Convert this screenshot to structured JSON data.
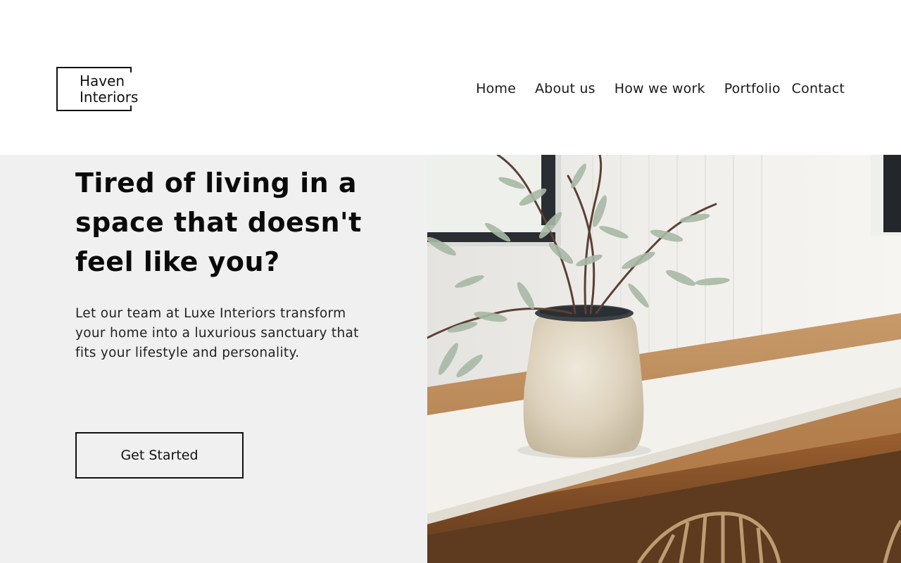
{
  "brand": {
    "logo_line1": "Haven",
    "logo_line2": "Interiors"
  },
  "nav": {
    "items": [
      {
        "label": "Home"
      },
      {
        "label": "About us"
      },
      {
        "label": "How we work"
      },
      {
        "label": "Portfolio"
      },
      {
        "label": "Contact"
      }
    ]
  },
  "hero": {
    "title": "Tired of living in a space that doesn't feel like you?",
    "description": "Let our team at Luxe Interiors transform your home into a luxurious sanctuary that fits your lifestyle and personality.",
    "cta_label": "Get Started"
  },
  "colors": {
    "text": "#111111",
    "hero_panel_bg": "#f0f0f0",
    "page_bg": "#ffffff"
  }
}
